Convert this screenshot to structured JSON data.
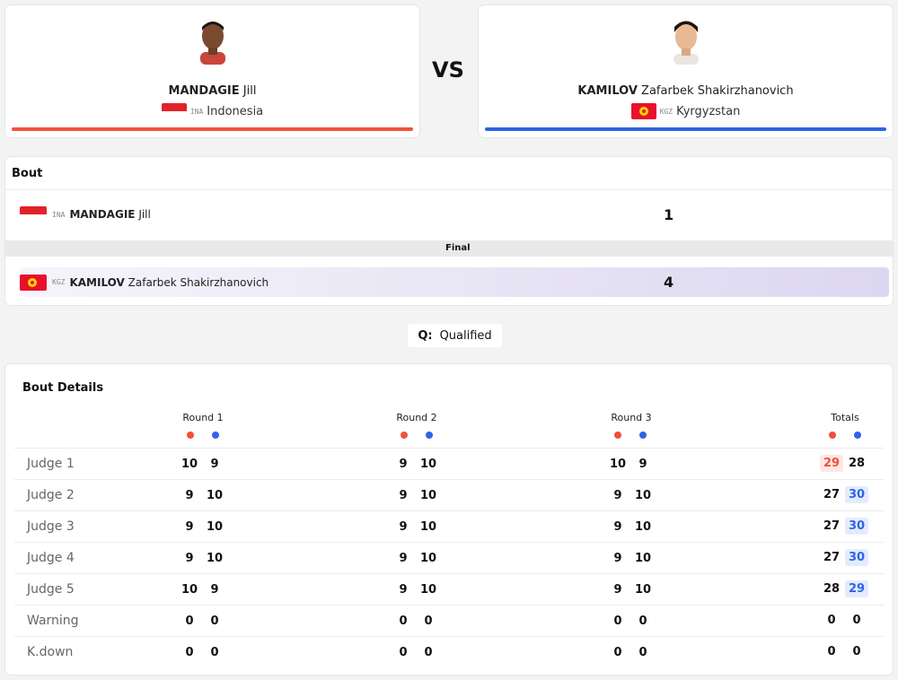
{
  "red": {
    "last_name": "MANDAGIE",
    "first_name": "Jill",
    "code": "INA",
    "country": "Indonesia",
    "color": "#f2503a"
  },
  "blue": {
    "last_name": "KAMILOV",
    "first_name": "Zafarbek Shakirzhanovich",
    "code": "KGZ",
    "country": "Kyrgyzstan",
    "color": "#2f64e6"
  },
  "vs_label": "VS",
  "bout": {
    "title": "Bout",
    "red_score": "1",
    "blue_score": "4",
    "status": "Final"
  },
  "qualified": {
    "key": "Q:",
    "text": "Qualified"
  },
  "details": {
    "title": "Bout Details",
    "columns": [
      "Round 1",
      "Round 2",
      "Round 3",
      "Totals"
    ],
    "rows": [
      {
        "label": "Judge 1",
        "r1": [
          "10",
          "9"
        ],
        "r2": [
          "9",
          "10"
        ],
        "r3": [
          "10",
          "9"
        ],
        "tot": [
          "29",
          "28"
        ],
        "winner": "red"
      },
      {
        "label": "Judge 2",
        "r1": [
          "9",
          "10"
        ],
        "r2": [
          "9",
          "10"
        ],
        "r3": [
          "9",
          "10"
        ],
        "tot": [
          "27",
          "30"
        ],
        "winner": "blue"
      },
      {
        "label": "Judge 3",
        "r1": [
          "9",
          "10"
        ],
        "r2": [
          "9",
          "10"
        ],
        "r3": [
          "9",
          "10"
        ],
        "tot": [
          "27",
          "30"
        ],
        "winner": "blue"
      },
      {
        "label": "Judge 4",
        "r1": [
          "9",
          "10"
        ],
        "r2": [
          "9",
          "10"
        ],
        "r3": [
          "9",
          "10"
        ],
        "tot": [
          "27",
          "30"
        ],
        "winner": "blue"
      },
      {
        "label": "Judge 5",
        "r1": [
          "10",
          "9"
        ],
        "r2": [
          "9",
          "10"
        ],
        "r3": [
          "9",
          "10"
        ],
        "tot": [
          "28",
          "29"
        ],
        "winner": "blue"
      },
      {
        "label": "Warning",
        "r1": [
          "0",
          "0"
        ],
        "r2": [
          "0",
          "0"
        ],
        "r3": [
          "0",
          "0"
        ],
        "tot": [
          "0",
          "0"
        ],
        "winner": "none"
      },
      {
        "label": "K.down",
        "r1": [
          "0",
          "0"
        ],
        "r2": [
          "0",
          "0"
        ],
        "r3": [
          "0",
          "0"
        ],
        "tot": [
          "0",
          "0"
        ],
        "winner": "none"
      }
    ]
  }
}
